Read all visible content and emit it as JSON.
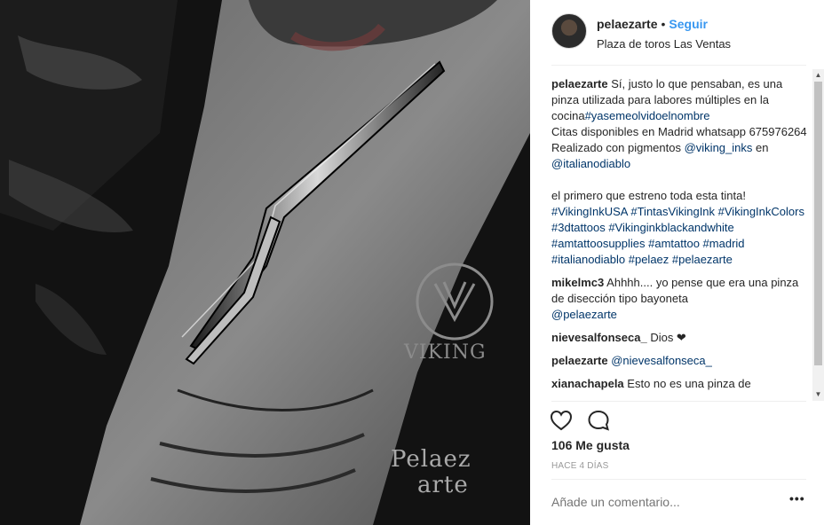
{
  "post": {
    "username": "pelaezarte",
    "separator": "•",
    "follow_label": "Seguir",
    "location": "Plaza de toros Las Ventas",
    "watermarks": {
      "viking": "VIKING",
      "pelaez": "Pelaez",
      "arte": "arte"
    }
  },
  "caption": {
    "username": "pelaezarte",
    "text1": "Sí, justo lo que pensaban, es una pinza utilizada para labores múltiples en la cocina",
    "hashtag1": "#yasemeolvidoelnombre",
    "text2": "Citas disponibles en Madrid  whatsapp 675976264 Realizado con pigmentos ",
    "mention1": "@viking_inks",
    "text3": " en ",
    "mention2": "@italianodiablo",
    "text4": "el primero que estreno toda esta tinta! ",
    "tags": "#VikingInkUSA #TintasVikingInk #VikingInkColors #3dtattoos #Vikinginkblackandwhite #amtattoosupplies #amtattoo #madrid #italianodiablo #pelaez #pelaezarte"
  },
  "comments": [
    {
      "user": "mikelmc3",
      "text": "Ahhhh.... yo pense que era una pinza de disección tipo bayoneta  ",
      "mention": "@pelaezarte"
    },
    {
      "user": "nievesalfonseca_",
      "text": "Dios ❤"
    },
    {
      "user": "pelaezarte",
      "mention": "@nievesalfonseca_",
      "text": " "
    },
    {
      "user": "xianachapela",
      "text": "Esto no es una pinza de"
    }
  ],
  "icons": {
    "like": "heart-icon",
    "comment": "comment-bubble-icon",
    "more": "more-dots-icon",
    "scroll_up": "▲",
    "scroll_down": "▼"
  },
  "likes": "106 Me gusta",
  "time": "HACE 4 DÍAS",
  "add_comment_placeholder": "Añade un comentario...",
  "more_label": "•••",
  "colors": {
    "link": "#003569",
    "follow": "#3897f0",
    "text": "#262626",
    "muted": "#999999"
  }
}
